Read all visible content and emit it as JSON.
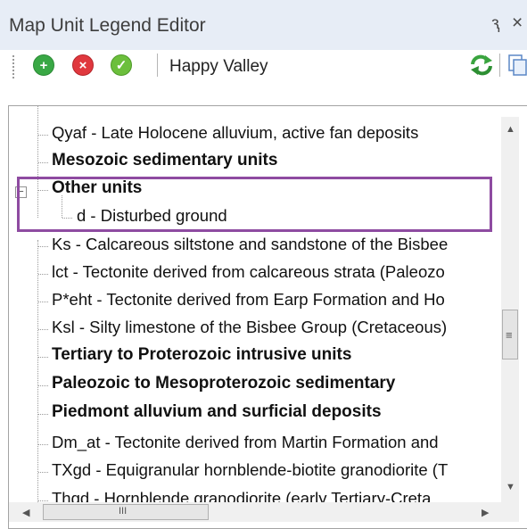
{
  "window": {
    "title": "Map Unit Legend Editor",
    "pin_glyph": "ԇ",
    "close_glyph": "×"
  },
  "toolbar": {
    "add_icon": "plus-circle-icon",
    "remove_icon": "x-circle-icon",
    "accept_icon": "check-circle-icon",
    "dataset_label": "Happy Valley",
    "refresh_icon": "refresh-icon",
    "copy_icon": "copy-icon"
  },
  "colors": {
    "add": "#39a845",
    "remove": "#e0383e",
    "accept": "#6cbf3c",
    "highlight": "#8e4ba1"
  },
  "tree": {
    "rows": [
      {
        "text": "Qyaf - Late Holocene alluvium, active fan deposits",
        "bold": false
      },
      {
        "text": "Mesozoic sedimentary units",
        "bold": true
      },
      {
        "text": "Other units",
        "bold": true
      },
      {
        "text": "d - Disturbed ground",
        "bold": false
      },
      {
        "text": "Ks - Calcareous siltstone and sandstone of the Bisbee",
        "bold": false
      },
      {
        "text": "lct - Tectonite derived from calcareous strata (Paleozo",
        "bold": false
      },
      {
        "text": "P*eht - Tectonite derived from Earp Formation and Ho",
        "bold": false
      },
      {
        "text": "Ksl - Silty limestone of the Bisbee Group (Cretaceous)",
        "bold": false
      },
      {
        "text": "Tertiary to Proterozoic intrusive units",
        "bold": true
      },
      {
        "text": "Paleozoic to Mesoproterozoic sedimentary",
        "bold": true
      },
      {
        "text": "Piedmont alluvium and surficial deposits",
        "bold": true
      },
      {
        "text": "Dm_at - Tectonite derived from Martin Formation and",
        "bold": false
      },
      {
        "text": "TXgd - Equigranular hornblende-biotite granodiorite (T",
        "bold": false
      },
      {
        "text": "Thgd - Hornblende granodiorite (early Tertiary-Creta",
        "bold": false
      }
    ],
    "expander_glyph": "−"
  },
  "scrollbars": {
    "up_glyph": "▲",
    "down_glyph": "▼",
    "left_glyph": "◀",
    "right_glyph": "▶",
    "grip_glyph": "≡",
    "hgrip_glyph": "III"
  }
}
